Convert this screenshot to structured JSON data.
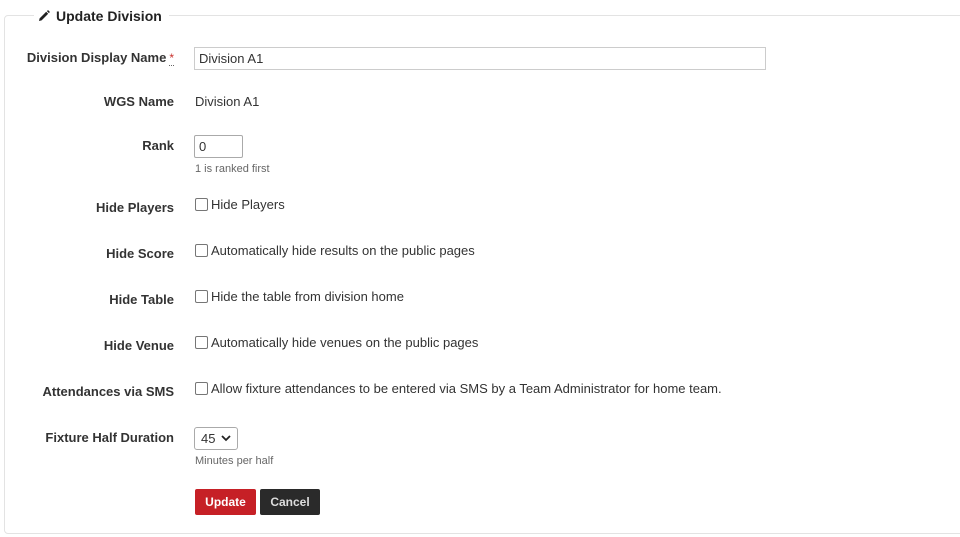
{
  "form": {
    "title": "Update Division",
    "fields": {
      "display_name": {
        "label": "Division Display Name",
        "required_mark": "*",
        "value": "Division A1"
      },
      "wgs_name": {
        "label": "WGS Name",
        "value": "Division A1"
      },
      "rank": {
        "label": "Rank",
        "value": "0",
        "help": "1 is ranked first"
      },
      "hide_players": {
        "label": "Hide Players",
        "checkbox_label": "Hide Players",
        "checked": false
      },
      "hide_score": {
        "label": "Hide Score",
        "checkbox_label": "Automatically hide results on the public pages",
        "checked": false
      },
      "hide_table": {
        "label": "Hide Table",
        "checkbox_label": "Hide the table from division home",
        "checked": false
      },
      "hide_venue": {
        "label": "Hide Venue",
        "checkbox_label": "Automatically hide venues on the public pages",
        "checked": false
      },
      "attendances_sms": {
        "label": "Attendances via SMS",
        "checkbox_label": "Allow fixture attendances to be entered via SMS by a Team Administrator for home team.",
        "checked": false
      },
      "fixture_half_duration": {
        "label": "Fixture Half Duration",
        "selected": "45",
        "help": "Minutes per half"
      }
    },
    "buttons": {
      "update": "Update",
      "cancel": "Cancel"
    }
  },
  "colors": {
    "update_button": "#c62026",
    "cancel_button": "#2a2a2a",
    "required": "#c9302c"
  },
  "icons": {
    "title_icon": "pencil-icon",
    "select_arrow": "chevron-down-icon"
  }
}
